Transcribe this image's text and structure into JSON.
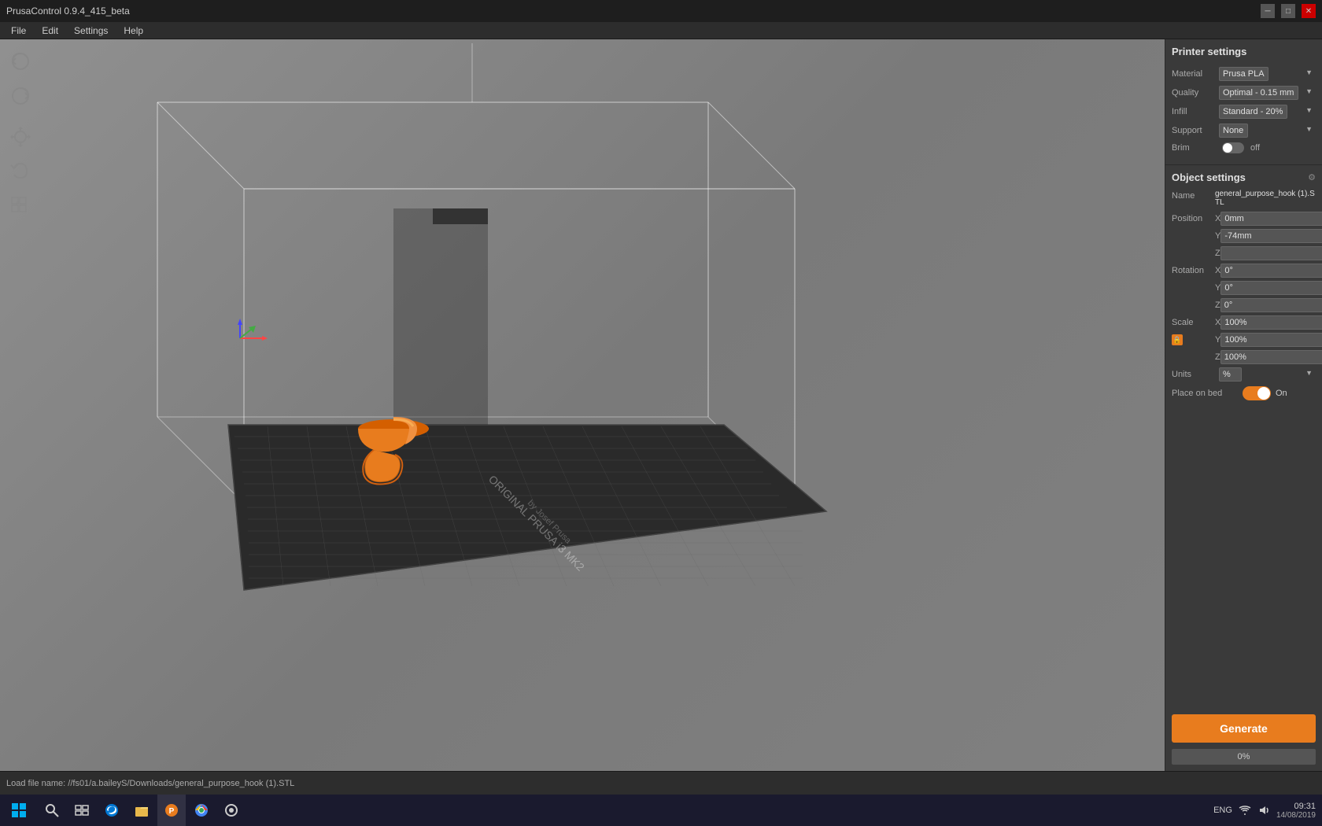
{
  "titlebar": {
    "title": "PrusaControl 0.9.4_415_beta",
    "min_btn": "─",
    "max_btn": "□",
    "close_btn": "✕"
  },
  "menubar": {
    "items": [
      "File",
      "Edit",
      "Settings",
      "Help"
    ]
  },
  "toolbar": {
    "tools": [
      "rotate-left",
      "rotate-right",
      "move",
      "undo",
      "grid"
    ]
  },
  "printer_settings": {
    "title": "Printer settings",
    "material_label": "Material",
    "material_value": "Prusa PLA",
    "quality_label": "Quality",
    "quality_value": "Optimal - 0.15 mm",
    "infill_label": "Infill",
    "infill_value": "Standard - 20%",
    "support_label": "Support",
    "support_value": "None",
    "brim_label": "Brim",
    "brim_value": "off"
  },
  "object_settings": {
    "title": "Object settings",
    "name_label": "Name",
    "name_value": "general_purpose_hook (1).STL",
    "position_label": "Position",
    "position_x": "0mm",
    "position_y": "-74mm",
    "position_z": "",
    "rotation_label": "Rotation",
    "rotation_x": "0°",
    "rotation_y": "0°",
    "rotation_z": "0°",
    "scale_label": "Scale",
    "scale_x": "100%",
    "scale_y": "100%",
    "scale_z": "100%",
    "units_label": "Units",
    "units_value": "%",
    "place_on_bed_label": "Place on bed",
    "place_on_bed_value": "On"
  },
  "generate_btn": "Generate",
  "progress": "0%",
  "statusbar": {
    "text": "Load file name: //fs01/a.baileyS/Downloads/general_purpose_hook (1).STL"
  },
  "taskbar": {
    "time": "09:31",
    "date": "14/08/2019",
    "lang": "ENG"
  }
}
